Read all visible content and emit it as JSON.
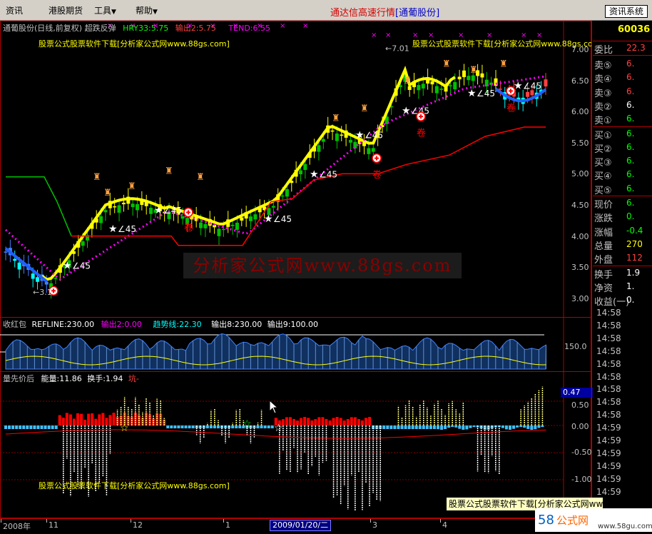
{
  "menu": {
    "items": [
      {
        "label": "资讯",
        "arrow": ""
      },
      {
        "label": "港股期货",
        "arrow": ""
      },
      {
        "label": "工具",
        "arrow": "▼"
      },
      {
        "label": "帮助",
        "arrow": "▼"
      }
    ],
    "title_red": "通达信高速行情",
    "title_blue": "[通葡股份]",
    "system_button": "资讯系统"
  },
  "main_chart": {
    "legend_name": "通葡股份(日线,前复权) 超跌反弹",
    "legend_hry": "HRY33:5.75",
    "legend_out2": "输出2:5.75",
    "legend_tend": "TEND:6.55",
    "price_labels": [
      "7.00",
      "6.50",
      "6.00",
      "5.50",
      "5.00",
      "4.50",
      "4.00",
      "3.50",
      "3.00"
    ],
    "watermark_top": "股票公式股票软件下载[分析家公式网www.88gs.com]",
    "watermark_big": "分析家公式网www.88gs.com",
    "high_label": "7.01",
    "low_label": "3.1",
    "angle_label": "∠45",
    "sell_char": "卷"
  },
  "mid_chart": {
    "legend_name": "收红包",
    "legend_refline": "REFLINE:230.00",
    "legend_out2": "输出2:0.00",
    "legend_trend": "趋势线:22.30",
    "legend_out8": "输出8:230.00",
    "legend_out9": "输出9:100.00",
    "y_label": "150.0"
  },
  "bottom_chart": {
    "legend_name": "量先价后",
    "legend_energy": "能量:11.86",
    "legend_turnover": "换手:1.94",
    "legend_kang": "坑-",
    "y_labels": [
      "0.50",
      "0.00",
      "-0.50",
      "-1.00"
    ],
    "highlight_value": "0.47",
    "watermark": "股票公式股票软件下载[分析家公式网www.88gs.com]"
  },
  "quote_panel": {
    "code": "60036",
    "ratio_label": "委比",
    "ratio_value": "22.3",
    "rows": [
      {
        "label": "卖⑤",
        "value": "6."
      },
      {
        "label": "卖④",
        "value": "6."
      },
      {
        "label": "卖③",
        "value": "6."
      },
      {
        "label": "卖②",
        "value": "6."
      },
      {
        "label": "卖①",
        "value": "6."
      },
      {
        "label": "买①",
        "value": "6."
      },
      {
        "label": "买②",
        "value": "6."
      },
      {
        "label": "买③",
        "value": "6."
      },
      {
        "label": "买④",
        "value": "6."
      },
      {
        "label": "买⑤",
        "value": "6."
      },
      {
        "label": "现价",
        "value": "6."
      },
      {
        "label": "涨跌",
        "value": "0."
      },
      {
        "label": "涨幅",
        "value": "-0.4"
      },
      {
        "label": "总量",
        "value": "270"
      },
      {
        "label": "外盘",
        "value": "112"
      },
      {
        "label": "换手",
        "value": "1.9"
      },
      {
        "label": "净资",
        "value": "1."
      },
      {
        "label": "收益(一)",
        "value": "0."
      }
    ],
    "times": [
      "14:58",
      "14:58",
      "14:58",
      "14:58",
      "14:58",
      "14:58",
      "14:58",
      "14:58",
      "14:58",
      "14:59",
      "14:59",
      "14:59",
      "14:59",
      "14:59",
      "14:59"
    ]
  },
  "x_axis": {
    "labels": [
      "2008年",
      "11",
      "12",
      "1",
      "3",
      "4"
    ],
    "selected_date": "2009/01/20/二"
  },
  "footer": {
    "banner": "股票公式股票软件下载[分析家公式网www.88gs.com]"
  },
  "colors": {
    "background": "#000000",
    "border": "#b00000",
    "up_line": "#ffff00",
    "ma_dots": "#ff00ff",
    "support_red": "#ff0000",
    "support_green": "#00c000"
  }
}
